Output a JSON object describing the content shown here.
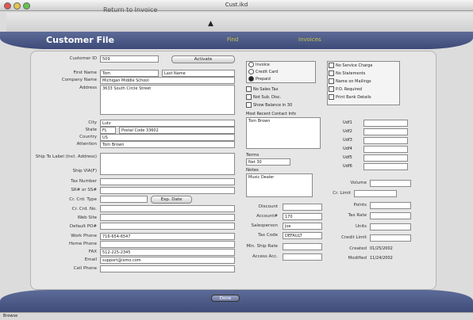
{
  "window": {
    "title": "Cust.ikd"
  },
  "toolbar": {
    "return_text": "Return to Invoice"
  },
  "header": {
    "title": "Customer File",
    "menu": [
      "Find",
      "Invoices"
    ]
  },
  "left": {
    "customer_id": {
      "label": "Customer ID",
      "value": "509",
      "button": "Activate"
    },
    "first_name": {
      "label": "First Name",
      "value": "Tom"
    },
    "last_name": {
      "label": "Last Name",
      "value": "Last Name"
    },
    "company": {
      "label": "Company Name",
      "value": "Michigan Middle School"
    },
    "address": {
      "label": "Address",
      "value": "3633 South Circle Street"
    },
    "city": {
      "label": "City",
      "value": "Lutz"
    },
    "state": {
      "label": "State",
      "value": "FL",
      "zip": "Postal Code 33602"
    },
    "country": {
      "label": "Country",
      "value": "US"
    },
    "attention": {
      "label": "Attention",
      "value": "Tom Brown"
    },
    "ship_address": {
      "label": "Ship To Label (Incl. Address)"
    },
    "ship_via": {
      "label": "Ship VIA(F)"
    },
    "tax_number": {
      "label": "Tax Number"
    },
    "sales_rep": {
      "label": "SR# or SS#"
    },
    "cc_type": {
      "label": "Cr. Crd. Type",
      "button": "Exp. Date"
    },
    "cc_number": {
      "label": "Cr. Crd. No."
    },
    "web_site": {
      "label": "Web Site"
    },
    "default_po": {
      "label": "Default PO#"
    },
    "work_phone": {
      "label": "Work Phone",
      "value": "716-654-6547"
    },
    "home_phone": {
      "label": "Home Phone",
      "value": ""
    },
    "fax": {
      "label": "FAX",
      "value": "512-225-2345"
    },
    "email": {
      "label": "Email",
      "value": "support@ixmo.com"
    },
    "cell_phone": {
      "label": "Cell Phone",
      "value": ""
    }
  },
  "middle": {
    "radios": [
      "Invoice",
      "Credit Card",
      "Prepaid"
    ],
    "radio_selected": 2,
    "checks": [
      "No Sales Tax",
      "Not Sub. Disc.",
      "Show Balance in 30"
    ],
    "last_contact_label": "Most Recent Contact Info",
    "last_contact_value": "Tom Brown",
    "terms": {
      "label": "Terms",
      "value": "Net 30"
    },
    "notes": {
      "label": "Notes",
      "value": "Music Dealer"
    },
    "discount": {
      "label": "Discount",
      "value": ""
    },
    "account": {
      "label": "Account#",
      "value": "170"
    },
    "salesperson": {
      "label": "Salesperson",
      "value": "Joe"
    },
    "tax_code": {
      "label": "Tax Code",
      "value": "DEFAULT"
    },
    "min_ship": {
      "label": "Min. Ship Rate",
      "value": ""
    },
    "access": {
      "label": "Access Acc.",
      "value": ""
    }
  },
  "right": {
    "checks": [
      "No Service Charge",
      "No Statements",
      "Name on Mailings",
      "P.O. Required",
      "Print Bank Details"
    ],
    "udf": [
      "Udf1",
      "Udf2",
      "Udf3",
      "Udf4",
      "Udf5",
      "Udf6"
    ],
    "fields": [
      {
        "label": "Volume",
        "value": ""
      },
      {
        "label": "Cr. Limit",
        "value": ""
      },
      {
        "label": "Points",
        "value": ""
      },
      {
        "label": "Tax Rate",
        "value": ""
      },
      {
        "label": "Units",
        "value": ""
      },
      {
        "label": "Credit Limit",
        "value": ""
      },
      {
        "label": "Created",
        "value": "01/25/2002"
      },
      {
        "label": "Modified",
        "value": "11/24/2002"
      }
    ]
  },
  "footer": {
    "done_label": "Done"
  },
  "status": {
    "text": "Browse"
  }
}
